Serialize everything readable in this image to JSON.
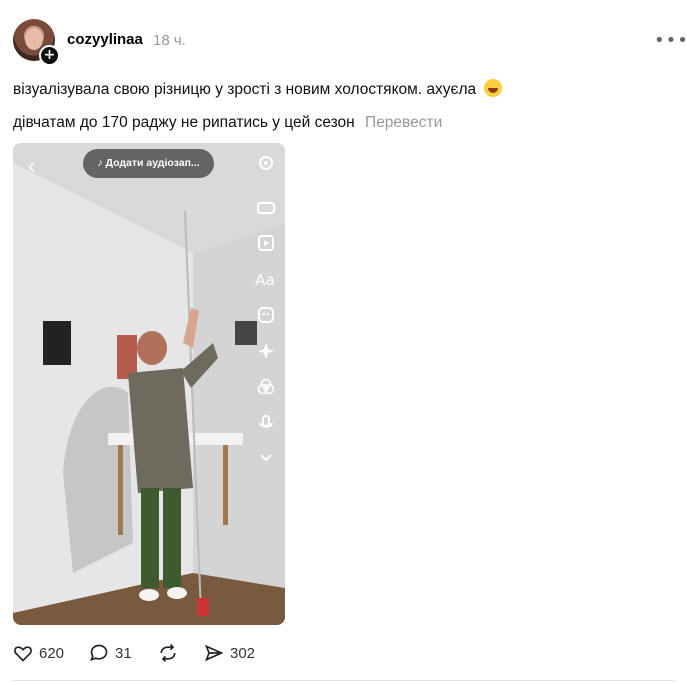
{
  "post": {
    "username": "cozyylinaa",
    "time": "18 ч.",
    "text_line1": "візуалізувала свою різницю у зрості з новим холостяком. ахуєла",
    "text_line2": "дівчатам до 170 раджу не рипатись у цей сезон",
    "translate_label": "Перевести",
    "more_label": "•••"
  },
  "video": {
    "audio_label": "♪ Додати аудіозап...",
    "back_glyph": "‹",
    "tools": [
      "settings-icon",
      "aspect-ratio-icon",
      "media-icon",
      "text-icon",
      "sticker-icon",
      "effects-icon",
      "filters-icon",
      "voice-icon",
      "chevron-down-icon"
    ],
    "text_tool_label": "Aa"
  },
  "actions": {
    "likes": "620",
    "comments": "31",
    "shares": "302"
  },
  "colors": {
    "muted": "#999999",
    "text": "#101010"
  }
}
